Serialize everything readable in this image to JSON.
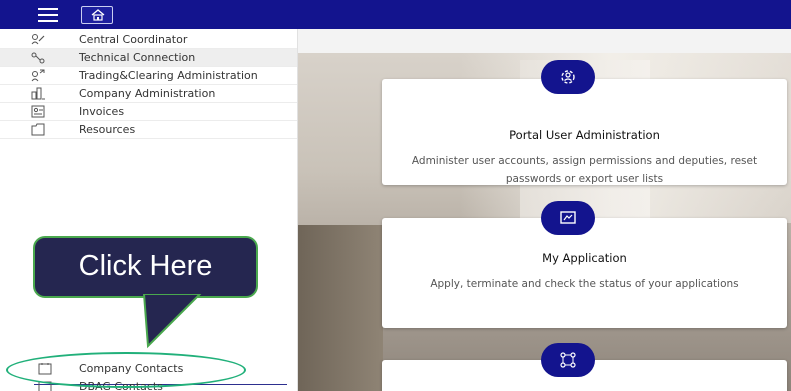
{
  "header": {
    "menu_icon": "hamburger-icon",
    "home_icon": "home-icon"
  },
  "sidebar": {
    "items": [
      {
        "label": "Central Coordinator",
        "icon": "coordinator-icon"
      },
      {
        "label": "Technical Connection",
        "icon": "connection-icon",
        "active": true
      },
      {
        "label": "Trading&Clearing Administration",
        "icon": "trading-icon"
      },
      {
        "label": "Company Administration",
        "icon": "company-icon"
      },
      {
        "label": "Invoices",
        "icon": "invoice-icon"
      },
      {
        "label": "Resources",
        "icon": "folder-icon"
      }
    ],
    "bottom_items": [
      {
        "label": "Company Contacts",
        "icon": "contacts-icon"
      },
      {
        "label": "DBAG Contacts",
        "icon": "contacts-icon"
      }
    ]
  },
  "callout": {
    "text": "Click Here"
  },
  "cards": [
    {
      "title": "Portal User Administration",
      "description": "Administer user accounts, assign permissions and deputies, reset passwords or export user lists",
      "icon": "user-admin-icon"
    },
    {
      "title": "My Application",
      "description": "Apply, terminate and check the status of your applications",
      "icon": "application-icon"
    },
    {
      "title": "",
      "description": "",
      "icon": "network-icon"
    }
  ],
  "colors": {
    "brand": "#13148e",
    "callout_bg": "#252650",
    "callout_border": "#4aa84e",
    "highlight_ellipse": "#21b07a"
  }
}
